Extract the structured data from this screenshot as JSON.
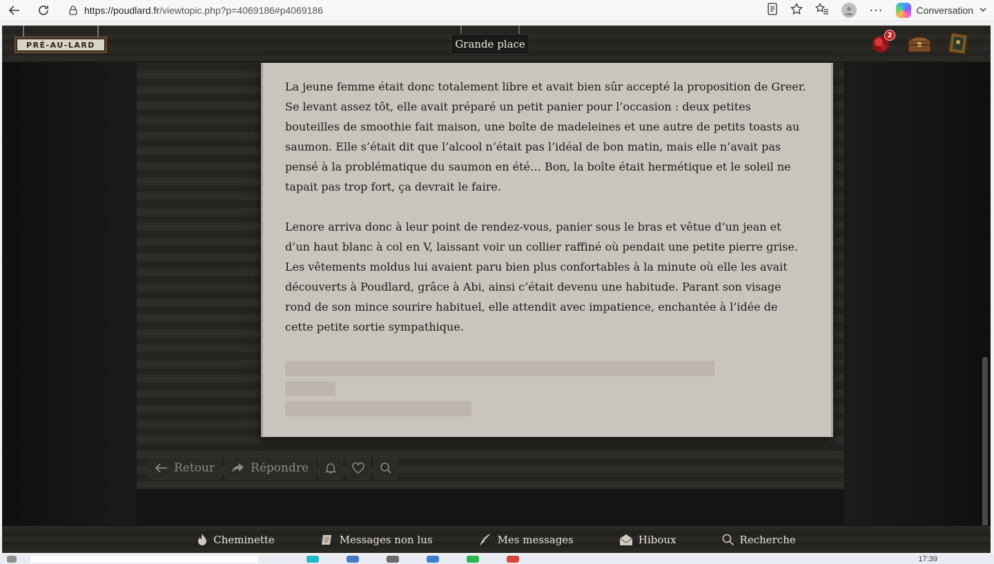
{
  "browser": {
    "url_host": "https://poudlard.fr",
    "url_path": "/viewtopic.php?p=4069186#p4069186",
    "copilot_label": "Conversation"
  },
  "header": {
    "sign_text": "PRÉ-AU-LARD",
    "place_label": "Grande place",
    "notification_count": "2"
  },
  "post": {
    "paragraphs": [
      "La jeune femme était donc totalement libre et avait bien sûr accepté la proposition de Greer. Se levant assez tôt, elle avait préparé un petit panier pour l’occasion : deux petites bouteilles de smoothie fait maison, une boîte de madeleines et une autre de petits toasts au saumon. Elle s’était dit que l’alcool n’était pas l’idéal de bon matin, mais elle n’avait pas pensé à la problématique du saumon en été… Bon, la boîte était hermétique et le soleil ne tapait pas trop fort, ça devrait le faire.",
      "Lenore arriva donc à leur point de rendez-vous, panier sous le bras et vêtue d’un jean et d’un haut blanc à col en V, laissant voir un collier raffiné où pendait une petite pierre grise. Les vêtements moldus lui avaient paru bien plus confortables à la minute où elle les avait découverts à Poudlard, grâce à Abi, ainsi c’était devenu une habitude. Parant son visage rond de son mince sourire habituel, elle attendit avec impatience, enchantée à l’idée de cette petite sortie sympathique."
    ]
  },
  "actions": {
    "back_label": "Retour",
    "reply_label": "Répondre"
  },
  "footer": {
    "items": [
      "Cheminette",
      "Messages non lus",
      "Mes messages",
      "Hiboux",
      "Recherche"
    ]
  },
  "taskbar": {
    "clock": "17:39"
  }
}
